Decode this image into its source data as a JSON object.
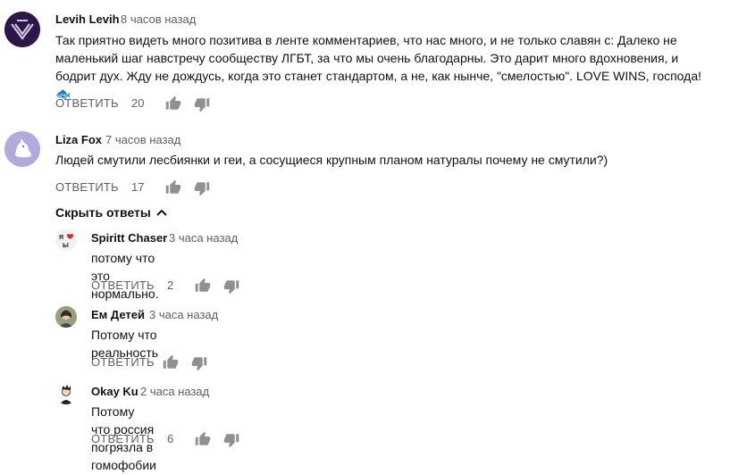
{
  "colors": {
    "text": "#111111",
    "secondary": "#606060",
    "icon": "#909090"
  },
  "comments": [
    {
      "author": "Levih Levih",
      "time": "8 часов назад",
      "text_line1": "Так приятно видеть много позитива в ленте комментариев, что нас много, и не только славян с: Далеко не",
      "text_line2": "маленький шаг навстречу сообществу ЛГБТ, за что мы очень благодарны. Это дарит много вдохновения, и",
      "text_line3": "бодрит дух. Жду не дождусь, когда это станет стандартом, а не, как нынче, \"смелостью\". LOVE WINS, господа! 🐟",
      "reply_label": "ОТВЕТИТЬ",
      "likes": "20"
    },
    {
      "author": "Liza Fox",
      "time": "7 часов назад",
      "text_line1": "Людей смутили лесбиянки и геи, а сосущиеся крупным планом натуралы почему не смутили?)",
      "reply_label": "ОТВЕТИТЬ",
      "likes": "17"
    }
  ],
  "hide_replies_label": "Скрыть ответы",
  "replies": [
    {
      "author": "Spiritt Chaser",
      "time": "3 часа назад",
      "text": "потому что это нормально.",
      "reply_label": "ОТВЕТИТЬ",
      "likes": "2",
      "avatar_text": "Я ♥ Ы"
    },
    {
      "author": "Ем Детей",
      "time": "3 часа назад",
      "text": "Потому что реальность",
      "reply_label": "ОТВЕТИТЬ",
      "likes": ""
    },
    {
      "author": "Okay Ku",
      "time": "2 часа назад",
      "text": "Потому что россия погрязла в гомофобии",
      "reply_label": "ОТВЕТИТЬ",
      "likes": "6"
    }
  ]
}
